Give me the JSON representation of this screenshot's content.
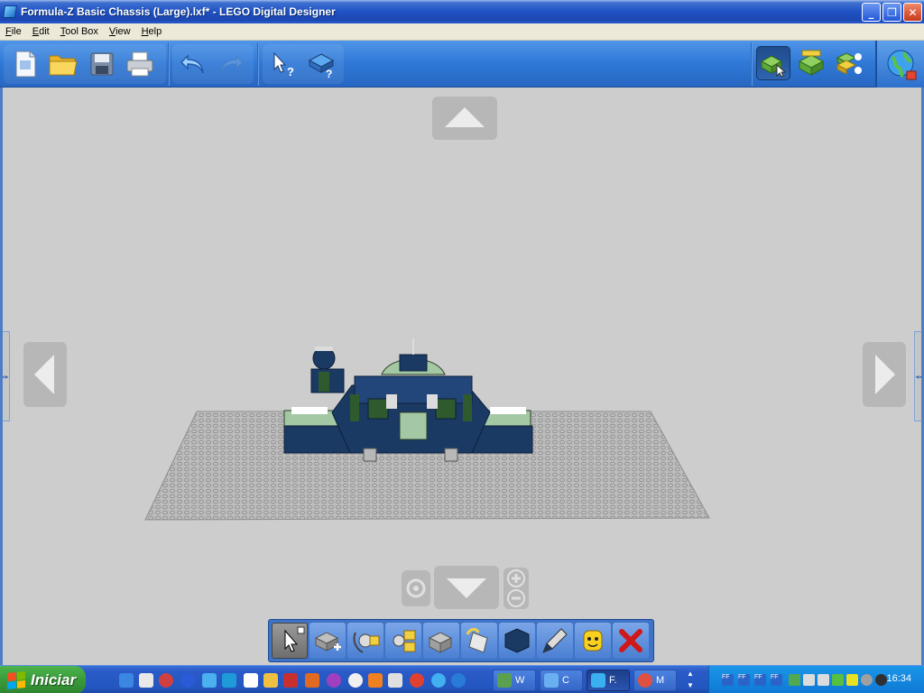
{
  "window": {
    "title": "Formula-Z Basic Chassis (Large).lxf* - LEGO Digital Designer",
    "controls": {
      "minimize": "_",
      "maximize": "❐",
      "close": "✕"
    }
  },
  "menu": {
    "items": [
      {
        "label": "File",
        "accel": "F",
        "rest": "ile"
      },
      {
        "label": "Edit",
        "accel": "E",
        "rest": "dit"
      },
      {
        "label": "Tool Box",
        "accel": "T",
        "rest": "ool Box"
      },
      {
        "label": "View",
        "accel": "V",
        "rest": "iew"
      },
      {
        "label": "Help",
        "accel": "H",
        "rest": "elp"
      }
    ]
  },
  "toolbar": {
    "icons": [
      "new-file-icon",
      "open-folder-icon",
      "save-icon",
      "print-icon",
      "undo-icon",
      "redo-icon",
      "select-help-icon",
      "brick-help-icon"
    ],
    "modes": [
      "build-mode-icon",
      "view-mode-icon",
      "building-guide-mode-icon"
    ],
    "globe": "share-globe-icon"
  },
  "tools": [
    {
      "name": "select-tool",
      "icon": "cursor-icon"
    },
    {
      "name": "clone-tool",
      "icon": "clone-icon"
    },
    {
      "name": "hinge-tool",
      "icon": "hinge-icon"
    },
    {
      "name": "hinge-align-tool",
      "icon": "hinge-align-icon"
    },
    {
      "name": "flex-tool",
      "icon": "flex-icon"
    },
    {
      "name": "paint-tool",
      "icon": "paint-bucket-icon"
    },
    {
      "name": "color-swatch",
      "icon": "color-swatch-icon",
      "color": "#1b3a63"
    },
    {
      "name": "color-picker-tool",
      "icon": "eyedropper-icon"
    },
    {
      "name": "decoration-tool",
      "icon": "minifig-head-icon"
    },
    {
      "name": "delete-tool",
      "icon": "delete-icon"
    }
  ],
  "taskbar": {
    "start_label": "Iniciar",
    "tasks": [
      {
        "label": "W",
        "icon": "live-messenger-icon"
      },
      {
        "label": "C",
        "icon": "people-icon"
      },
      {
        "label": "F.",
        "icon": "lego-designer-icon"
      },
      {
        "label": "M",
        "icon": "chrome-icon"
      }
    ],
    "tray_labels": [
      "FF",
      "FF",
      "FF",
      "FF"
    ],
    "clock": "16:34"
  },
  "colors": {
    "baseplate": "#b9b9b9",
    "model_dark_blue": "#1b3a63",
    "model_green": "#2e5a2e",
    "model_light_green": "#a4c8a4"
  }
}
